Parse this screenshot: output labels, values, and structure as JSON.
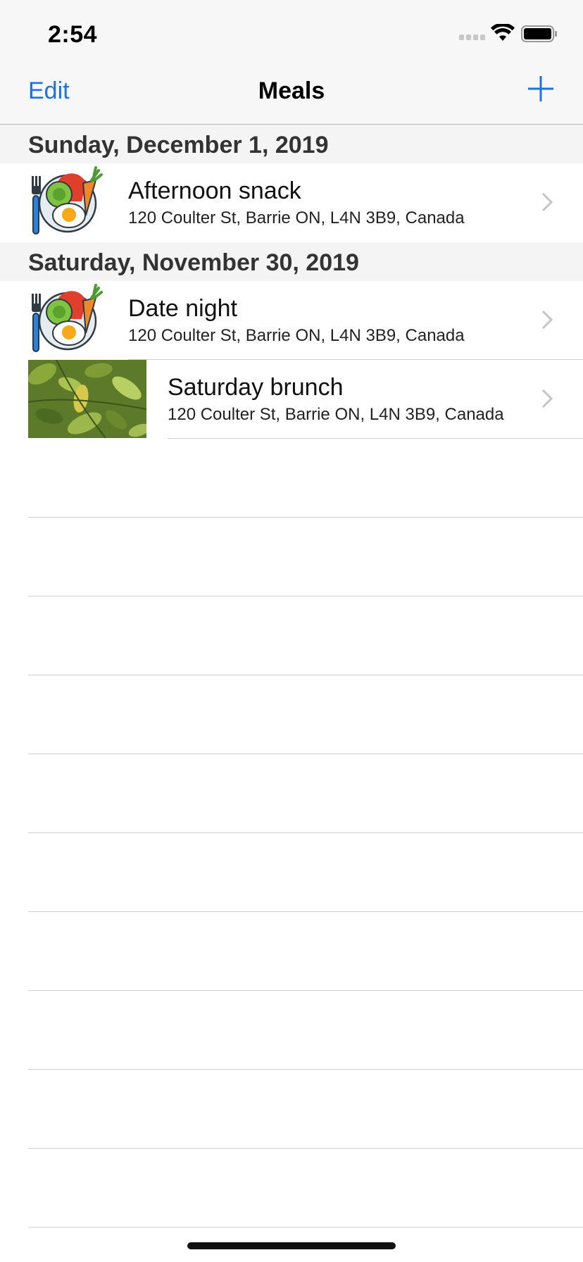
{
  "status_bar": {
    "time": "2:54"
  },
  "nav": {
    "edit_label": "Edit",
    "title": "Meals",
    "add_icon": "plus-icon"
  },
  "sections": [
    {
      "header": "Sunday, December 1, 2019",
      "rows": [
        {
          "title": "Afternoon snack",
          "address": "120 Coulter St, Barrie ON, L4N 3B9, Canada",
          "thumbnail": "meal-plate-icon"
        }
      ]
    },
    {
      "header": "Saturday, November 30, 2019",
      "rows": [
        {
          "title": "Date night",
          "address": "120 Coulter St, Barrie ON, L4N 3B9, Canada",
          "thumbnail": "meal-plate-icon"
        },
        {
          "title": "Saturday brunch",
          "address": "120 Coulter St, Barrie ON, L4N 3B9, Canada",
          "thumbnail": "leaves-photo"
        }
      ]
    }
  ],
  "colors": {
    "accent": "#1a73e8",
    "section_bg": "#f4f4f4",
    "bar_bg": "#f7f7f7"
  }
}
